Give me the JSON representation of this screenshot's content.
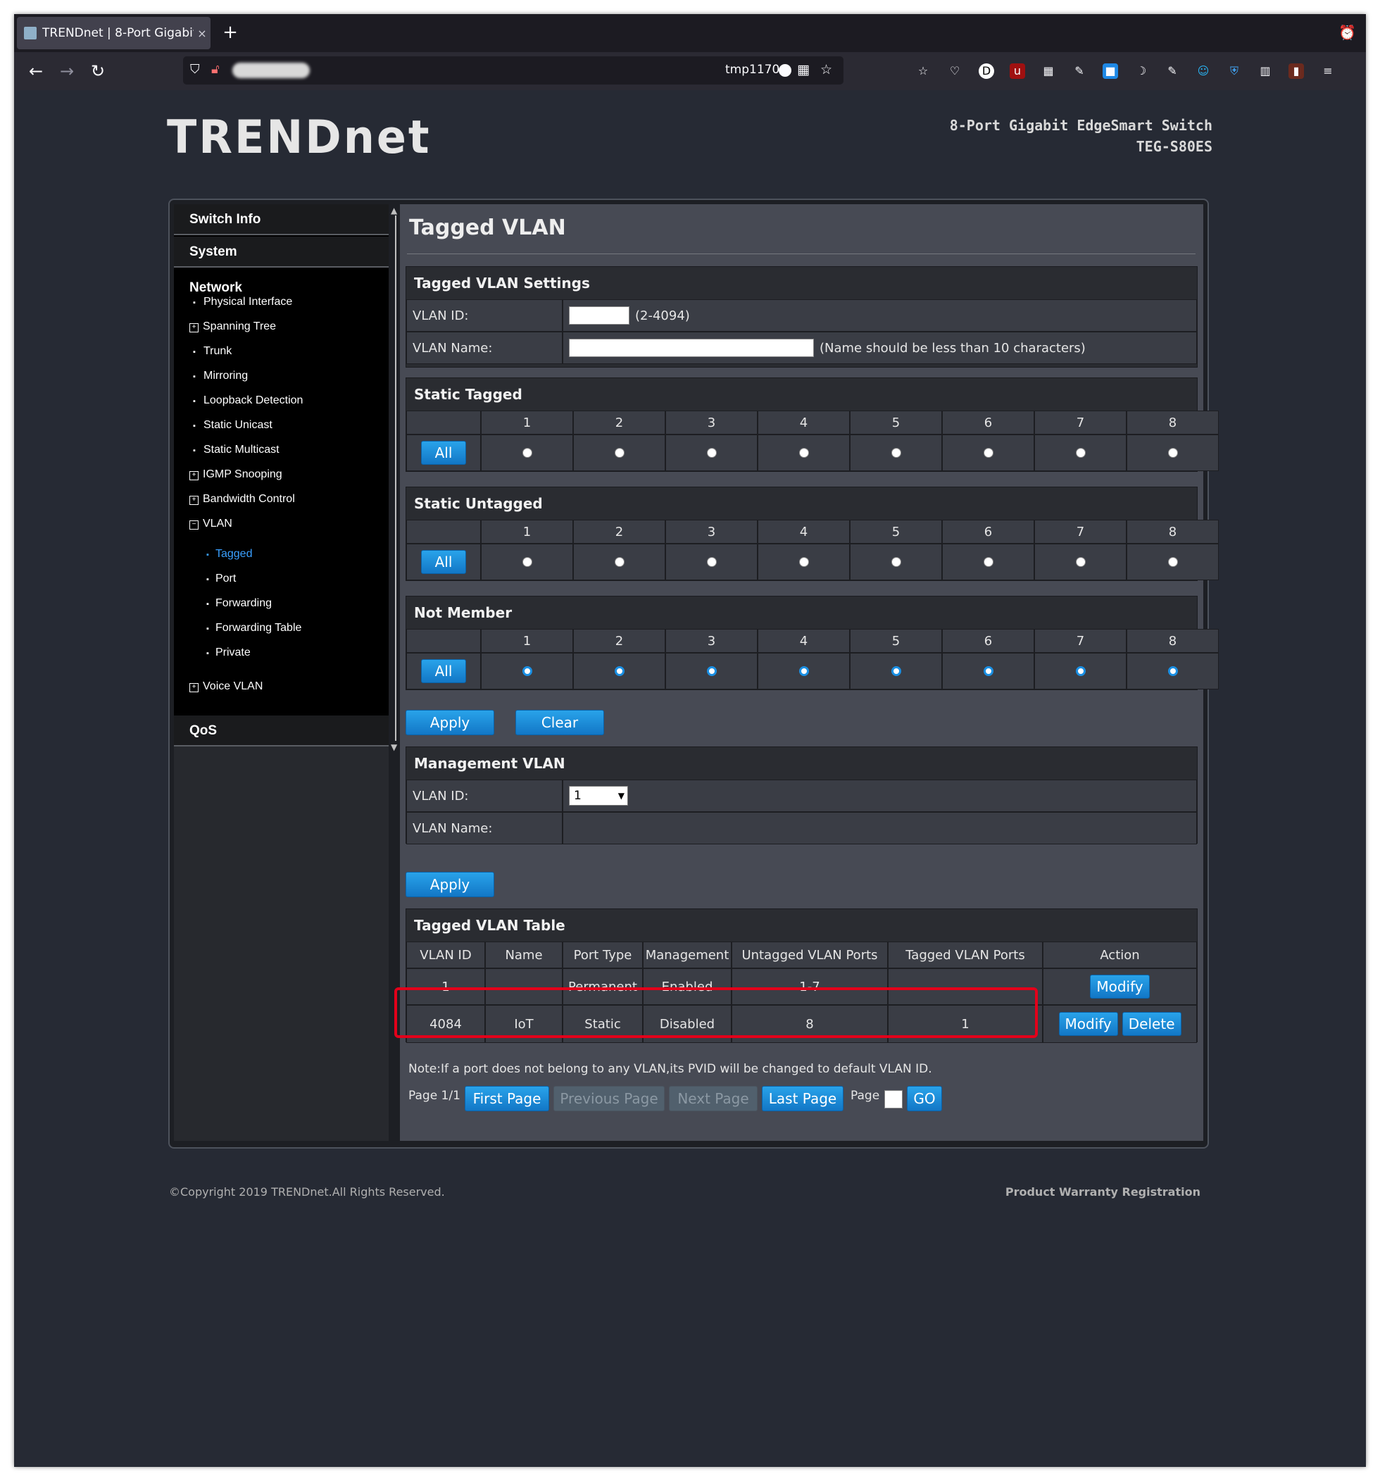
{
  "browser": {
    "tab_title": "TRENDnet | 8-Port Gigabit",
    "tab_close": "×",
    "new_tab": "+",
    "url_text": "tmp1170",
    "icons": [
      "back-icon",
      "forward-icon",
      "reload-icon",
      "shield-icon",
      "lock-icon",
      "grid-icon",
      "star-icon",
      "menu-icon"
    ]
  },
  "header": {
    "logo": "TRENDnet",
    "product_line": "8-Port Gigabit EdgeSmart Switch",
    "model": "TEG-S80ES"
  },
  "sidebar": {
    "switch_info": "Switch Info",
    "system": "System",
    "network": "Network",
    "items": [
      {
        "label": "Physical Interface",
        "marker": "bullet"
      },
      {
        "label": "Spanning Tree",
        "marker": "plus"
      },
      {
        "label": "Trunk",
        "marker": "bullet"
      },
      {
        "label": "Mirroring",
        "marker": "bullet"
      },
      {
        "label": "Loopback Detection",
        "marker": "bullet"
      },
      {
        "label": "Static Unicast",
        "marker": "bullet"
      },
      {
        "label": "Static Multicast",
        "marker": "bullet"
      },
      {
        "label": "IGMP Snooping",
        "marker": "plus"
      },
      {
        "label": "Bandwidth Control",
        "marker": "plus"
      },
      {
        "label": "VLAN",
        "marker": "minus"
      }
    ],
    "vlan_sub": [
      "Tagged",
      "Port",
      "Forwarding",
      "Forwarding Table",
      "Private"
    ],
    "vlan_active": "Tagged",
    "voice_vlan": "Voice VLAN",
    "qos": "QoS",
    "active_color": "#3aa0ff"
  },
  "main": {
    "title": "Tagged VLAN",
    "settings": {
      "header": "Tagged VLAN Settings",
      "vlan_id_label": "VLAN ID:",
      "vlan_id_value": "",
      "vlan_id_hint": "(2-4094)",
      "vlan_name_label": "VLAN Name:",
      "vlan_name_value": "",
      "vlan_name_hint": "(Name should be less than 10 characters)"
    },
    "ports": [
      "1",
      "2",
      "3",
      "4",
      "5",
      "6",
      "7",
      "8"
    ],
    "all_label": "All",
    "static_tagged": {
      "header": "Static Tagged",
      "selected": [
        false,
        false,
        false,
        false,
        false,
        false,
        false,
        false
      ]
    },
    "static_untagged": {
      "header": "Static Untagged",
      "selected": [
        false,
        false,
        false,
        false,
        false,
        false,
        false,
        false
      ]
    },
    "not_member": {
      "header": "Not Member",
      "selected": [
        true,
        true,
        true,
        true,
        true,
        true,
        true,
        true
      ]
    },
    "apply_label": "Apply",
    "clear_label": "Clear",
    "management": {
      "header": "Management VLAN",
      "vlan_id_label": "VLAN ID:",
      "vlan_id_selected": "1",
      "vlan_name_label": "VLAN Name:",
      "vlan_name_value": "",
      "apply_label": "Apply"
    },
    "table": {
      "header": "Tagged VLAN Table",
      "columns": [
        "VLAN ID",
        "Name",
        "Port Type",
        "Management",
        "Untagged VLAN Ports",
        "Tagged VLAN Ports",
        "Action"
      ],
      "rows": [
        {
          "vlan_id": "1",
          "name": "",
          "port_type": "Permanent",
          "management": "Enabled",
          "untagged": "1-7",
          "tagged": "",
          "actions": [
            "Modify"
          ]
        },
        {
          "vlan_id": "4084",
          "name": "IoT",
          "port_type": "Static",
          "management": "Disabled",
          "untagged": "8",
          "tagged": "1",
          "actions": [
            "Modify",
            "Delete"
          ]
        }
      ],
      "highlight_color": "#e3001a"
    },
    "note": "Note:If a port does not belong to any VLAN,its PVID will be changed to default VLAN ID.",
    "pager": {
      "page_info": "Page 1/1",
      "first": "First Page",
      "previous": "Previous Page",
      "next": "Next Page",
      "last": "Last Page",
      "page_label": "Page",
      "page_value": "",
      "go": "GO"
    }
  },
  "footer": {
    "copyright": "©Copyright 2019 TRENDnet.All Rights Reserved.",
    "warranty": "Product Warranty Registration"
  }
}
